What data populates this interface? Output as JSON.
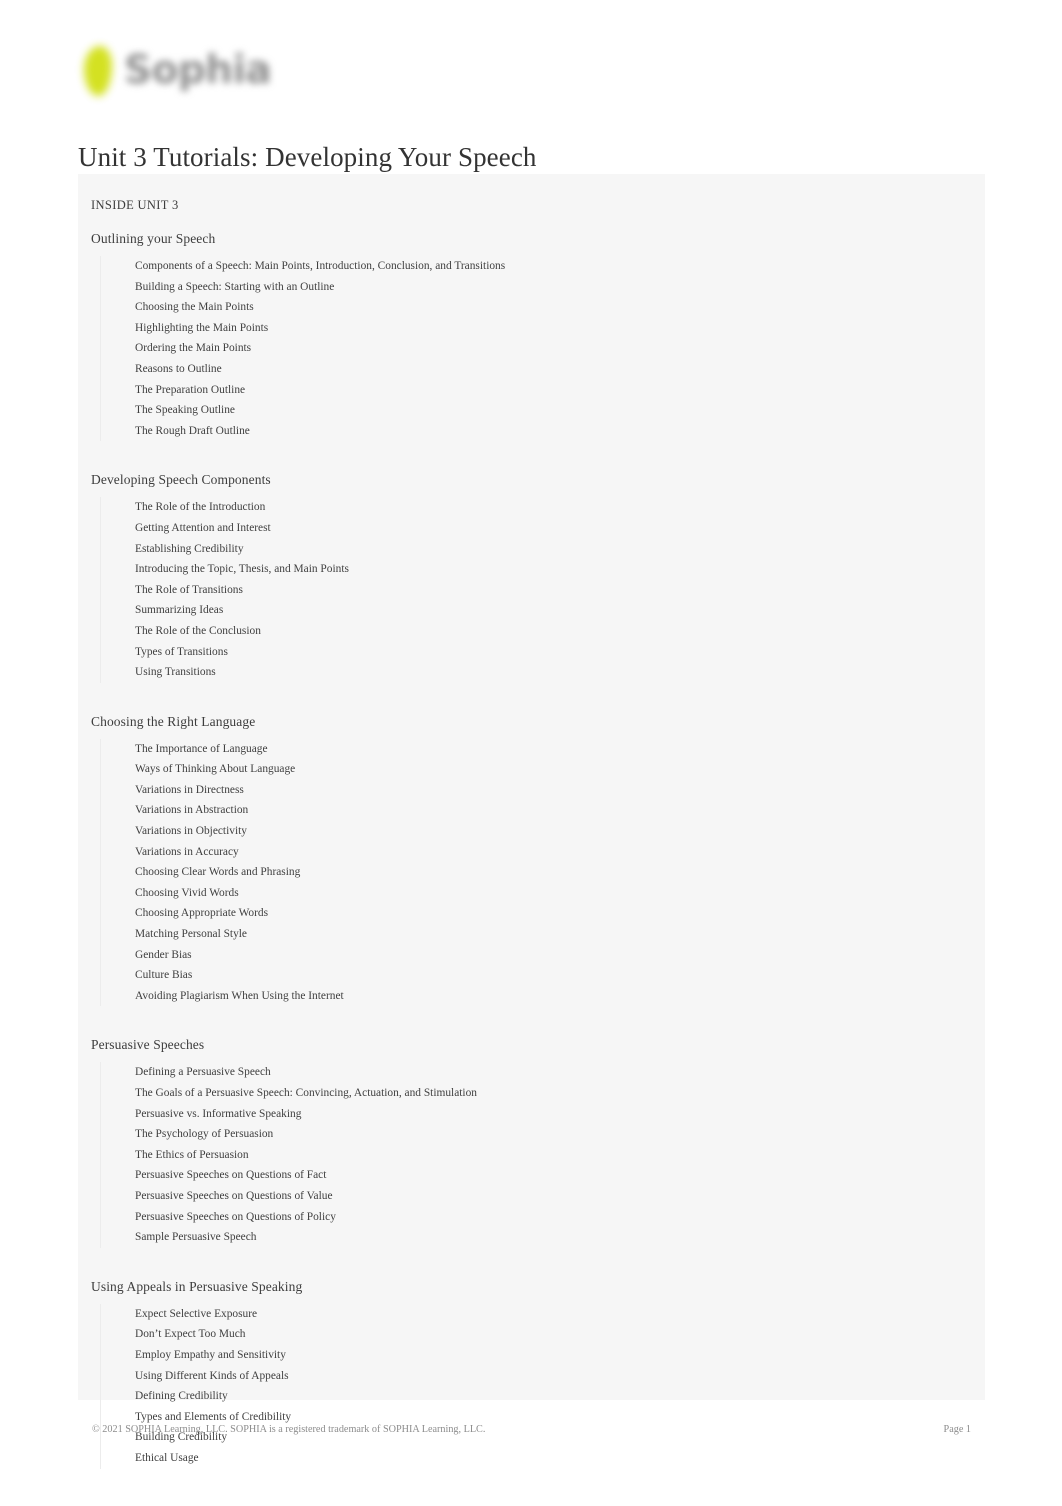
{
  "brand": {
    "logo_mark": "leaf-icon",
    "wordmark": "Sophia",
    "mark_color": "#d2e017",
    "wordmark_color": "#8f8f8f"
  },
  "document": {
    "title": "Unit 3 Tutorials: Developing Your Speech",
    "inside_heading": "INSIDE UNIT 3"
  },
  "sections": [
    {
      "title": "Outlining your Speech",
      "items": [
        "Components of a Speech: Main Points, Introduction, Conclusion, and Transitions",
        "Building a Speech: Starting with an Outline",
        "Choosing the Main Points",
        "Highlighting the Main Points",
        "Ordering the Main Points",
        "Reasons to Outline",
        "The Preparation Outline",
        "The Speaking Outline",
        "The Rough Draft Outline"
      ]
    },
    {
      "title": "Developing Speech Components",
      "items": [
        "The Role of the Introduction",
        "Getting Attention and Interest",
        "Establishing Credibility",
        "Introducing the Topic, Thesis, and Main Points",
        "The Role of Transitions",
        "Summarizing Ideas",
        "The Role of the Conclusion",
        "Types of Transitions",
        "Using Transitions"
      ]
    },
    {
      "title": "Choosing the Right Language",
      "items": [
        "The Importance of Language",
        "Ways of Thinking About Language",
        "Variations in Directness",
        "Variations in Abstraction",
        "Variations in Objectivity",
        "Variations in Accuracy",
        "Choosing Clear Words and Phrasing",
        "Choosing Vivid Words",
        "Choosing Appropriate Words",
        "Matching Personal Style",
        "Gender Bias",
        "Culture Bias",
        "Avoiding Plagiarism When Using the Internet"
      ]
    },
    {
      "title": "Persuasive Speeches",
      "items": [
        "Defining a Persuasive Speech",
        "The Goals of a Persuasive Speech: Convincing, Actuation, and Stimulation",
        "Persuasive vs. Informative Speaking",
        "The Psychology of Persuasion",
        "The Ethics of Persuasion",
        "Persuasive Speeches on Questions of Fact",
        "Persuasive Speeches on Questions of Value",
        "Persuasive Speeches on Questions of Policy",
        "Sample Persuasive Speech"
      ]
    },
    {
      "title": "Using Appeals in Persuasive Speaking",
      "items": [
        "Expect Selective Exposure",
        "Don’t Expect Too Much",
        "Employ Empathy and Sensitivity",
        "Using Different Kinds of Appeals",
        "Defining Credibility",
        "Types and Elements of Credibility",
        "Building Credibility",
        "Ethical Usage"
      ]
    }
  ],
  "footer": {
    "copyright": "© 2021 SOPHIA Learning, LLC. SOPHIA is a registered trademark of SOPHIA Learning, LLC.",
    "page_label": "Page 1"
  }
}
